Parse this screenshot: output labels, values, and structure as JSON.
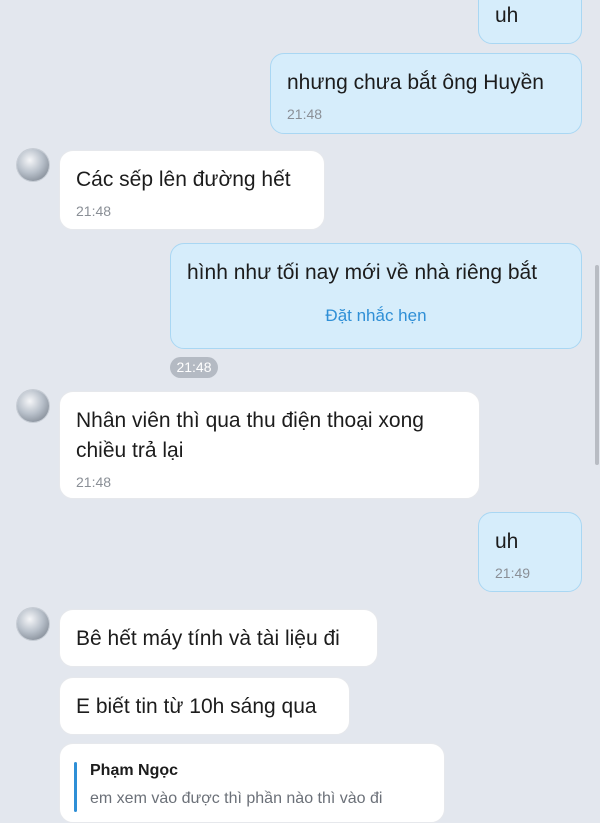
{
  "messages": [
    {
      "text": "uh",
      "time": ""
    },
    {
      "text": "nhưng chưa bắt ông Huyền",
      "time": "21:48"
    },
    {
      "text": "Các sếp lên đường hết",
      "time": "21:48"
    },
    {
      "text": "hình như tối nay mới về nhà riêng bắt",
      "action": "Đặt nhắc hẹn",
      "time": "21:48"
    },
    {
      "lines": [
        "Nhân viên thì qua thu điện thoại xong",
        "chiều trả lại"
      ],
      "time": "21:48"
    },
    {
      "text": "uh",
      "time": "21:49"
    },
    {
      "text": "Bê hết máy tính và tài liệu đi"
    },
    {
      "text": "E biết tin từ 10h sáng qua"
    },
    {
      "quote_sender": "Phạm Ngọc",
      "quote_text": "em xem vào được thì phần nào thì vào đi"
    }
  ],
  "colors": {
    "background": "#e3e7ee",
    "outgoing_bubble": "#d6edfb",
    "incoming_bubble": "#ffffff",
    "link": "#2f8fd6",
    "timestamp": "#8a8f96"
  },
  "icons": {
    "avatar": "contact-avatar"
  }
}
